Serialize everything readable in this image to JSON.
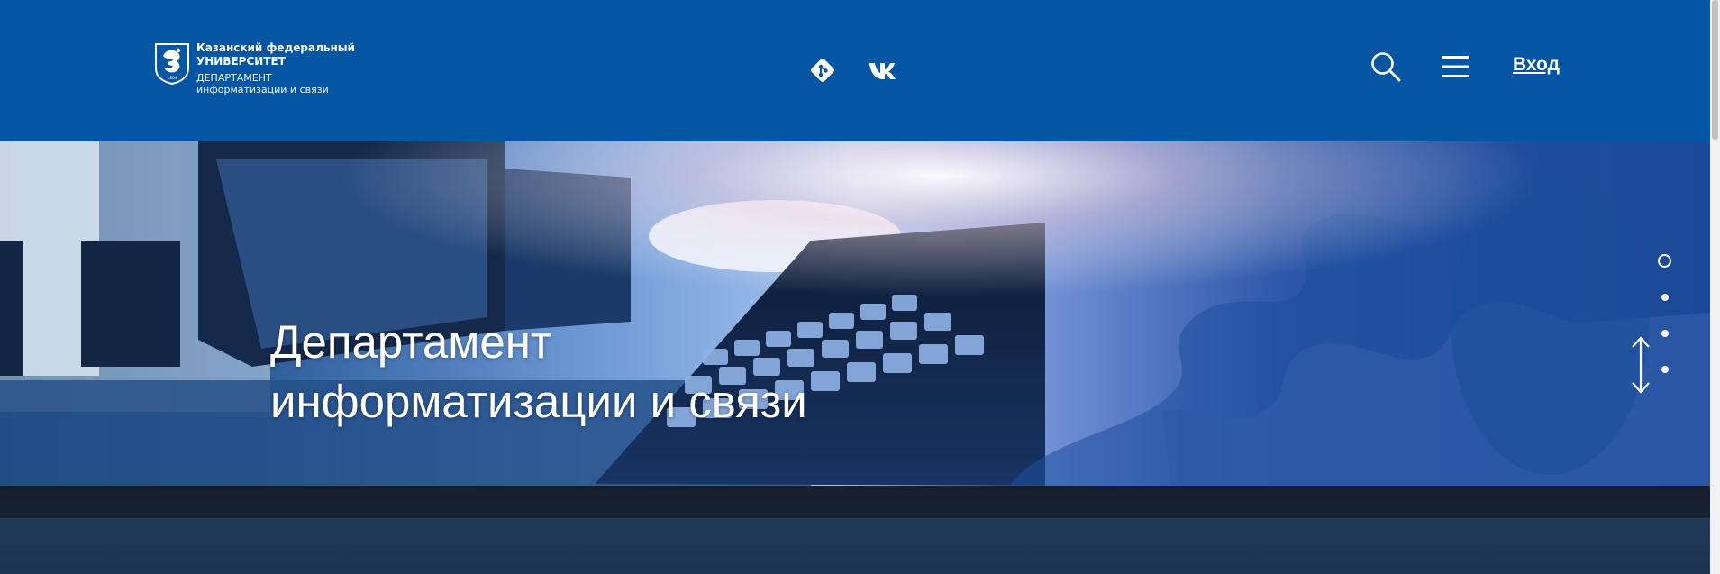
{
  "header": {
    "logo": {
      "line1": "Казанский федеральный",
      "line2": "УНИВЕРСИТЕТ",
      "line3": "ДЕПАРТАМЕНТ",
      "line4": "информатизации и связи",
      "emblem_icon": "kfu-leopard-emblem-icon"
    },
    "social": [
      {
        "name": "git",
        "icon": "git-icon"
      },
      {
        "name": "vk",
        "icon": "vk-icon"
      }
    ],
    "search_icon": "search-icon",
    "menu_icon": "hamburger-menu-icon",
    "login_label": "Вход"
  },
  "hero": {
    "title_line1": "Департамент",
    "title_line2": "информатизации и связи"
  },
  "slider": {
    "dots": 4,
    "active_index": 0
  },
  "colors": {
    "header_bg": "#0455a3",
    "text": "#ffffff"
  }
}
